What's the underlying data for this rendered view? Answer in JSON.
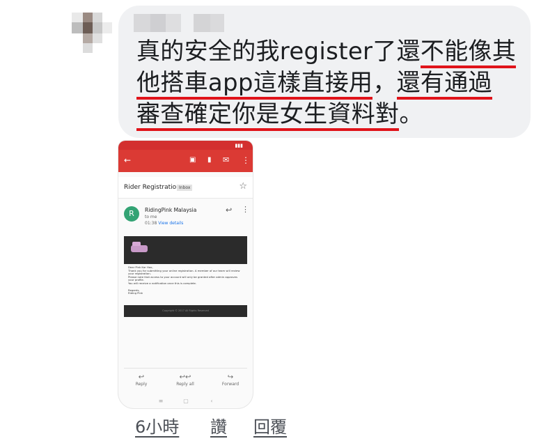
{
  "message": {
    "text_plain": "真的安全的我register了還",
    "text_u1": "不能像其",
    "text_u2": "他搭車app這樣直接用",
    "text_mid": "，",
    "text_u3": "還有通過",
    "text_u4": "審查確定你是女生資料對",
    "text_end": "。"
  },
  "screenshot": {
    "subject": "Rider Registration",
    "inbox_label": "Inbox",
    "sender_initial": "R",
    "sender": "RidingPink Malaysia",
    "to": "to me",
    "time": "01:38",
    "view_details": "View details",
    "body_lines": [
      "Dear Pink Kar Hoo,",
      "Thank you for submitting your online registration. A member of our team will review",
      "your registration.",
      "Please note that access to your account will only be granted after admin approves",
      "your profile.",
      "You will receive a notification once this is complete."
    ],
    "signoff": [
      "Regards,",
      "Riding Pink"
    ],
    "footer": "Copyright © 2017 All Rights Reserved",
    "actions": {
      "reply": "Reply",
      "reply_all": "Reply all",
      "forward": "Forward"
    }
  },
  "meta": {
    "time_ago": "6小時",
    "like": "讚",
    "reply": "回覆"
  },
  "colors": {
    "bubble": "#f0f1f3",
    "underline": "#e0131a",
    "gmail_red": "#db3a34",
    "meta_text": "#4b4f56"
  }
}
